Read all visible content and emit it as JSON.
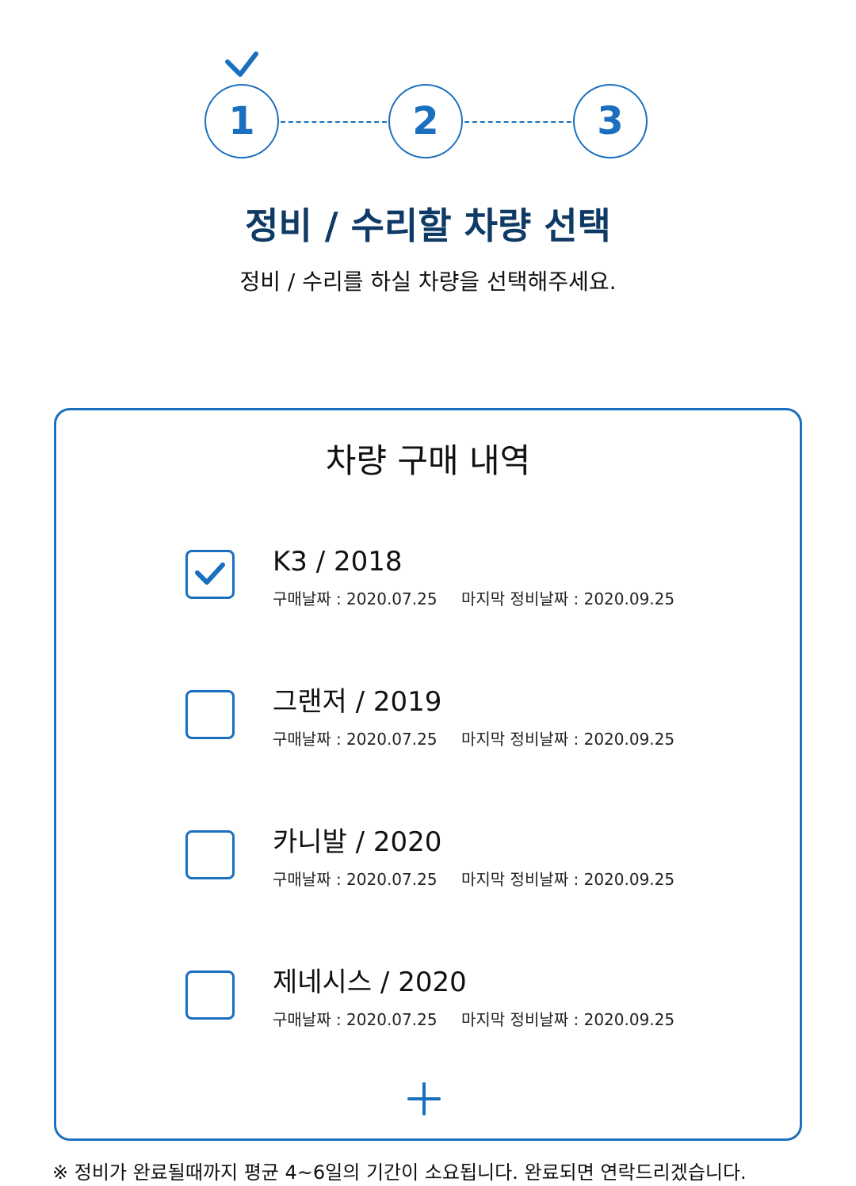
{
  "stepper": {
    "steps": [
      "1",
      "2",
      "3"
    ],
    "current_step": 1,
    "completed_icon": "check-icon"
  },
  "header": {
    "title": "정비 / 수리할 차량 선택",
    "subtitle": "정비 / 수리를 하실 차량을 선택해주세요."
  },
  "purchase_history": {
    "title": "차량 구매 내역",
    "vehicles": [
      {
        "name": "K3 / 2018",
        "purchase_date": "구매날짜 : 2020.07.25",
        "last_service_date": "마지막 정비날짜 : 2020.09.25",
        "checked": true
      },
      {
        "name": "그랜저 / 2019",
        "purchase_date": "구매날짜 : 2020.07.25",
        "last_service_date": "마지막 정비날짜 : 2020.09.25",
        "checked": false
      },
      {
        "name": "카니발 / 2020",
        "purchase_date": "구매날짜 : 2020.07.25",
        "last_service_date": "마지막 정비날짜 : 2020.09.25",
        "checked": false
      },
      {
        "name": "제네시스 / 2020",
        "purchase_date": "구매날짜 : 2020.07.25",
        "last_service_date": "마지막 정비날짜 : 2020.09.25",
        "checked": false
      }
    ],
    "add_icon": "plus-icon"
  },
  "notice": "※ 정비가 완료될때까지 평균 4~6일의 기간이 소요됩니다. 완료되면 연락드리겠습니다.",
  "colors": {
    "accent": "#1a6fbe",
    "title": "#0f3a66",
    "text": "#111111",
    "background": "#ffffff"
  }
}
